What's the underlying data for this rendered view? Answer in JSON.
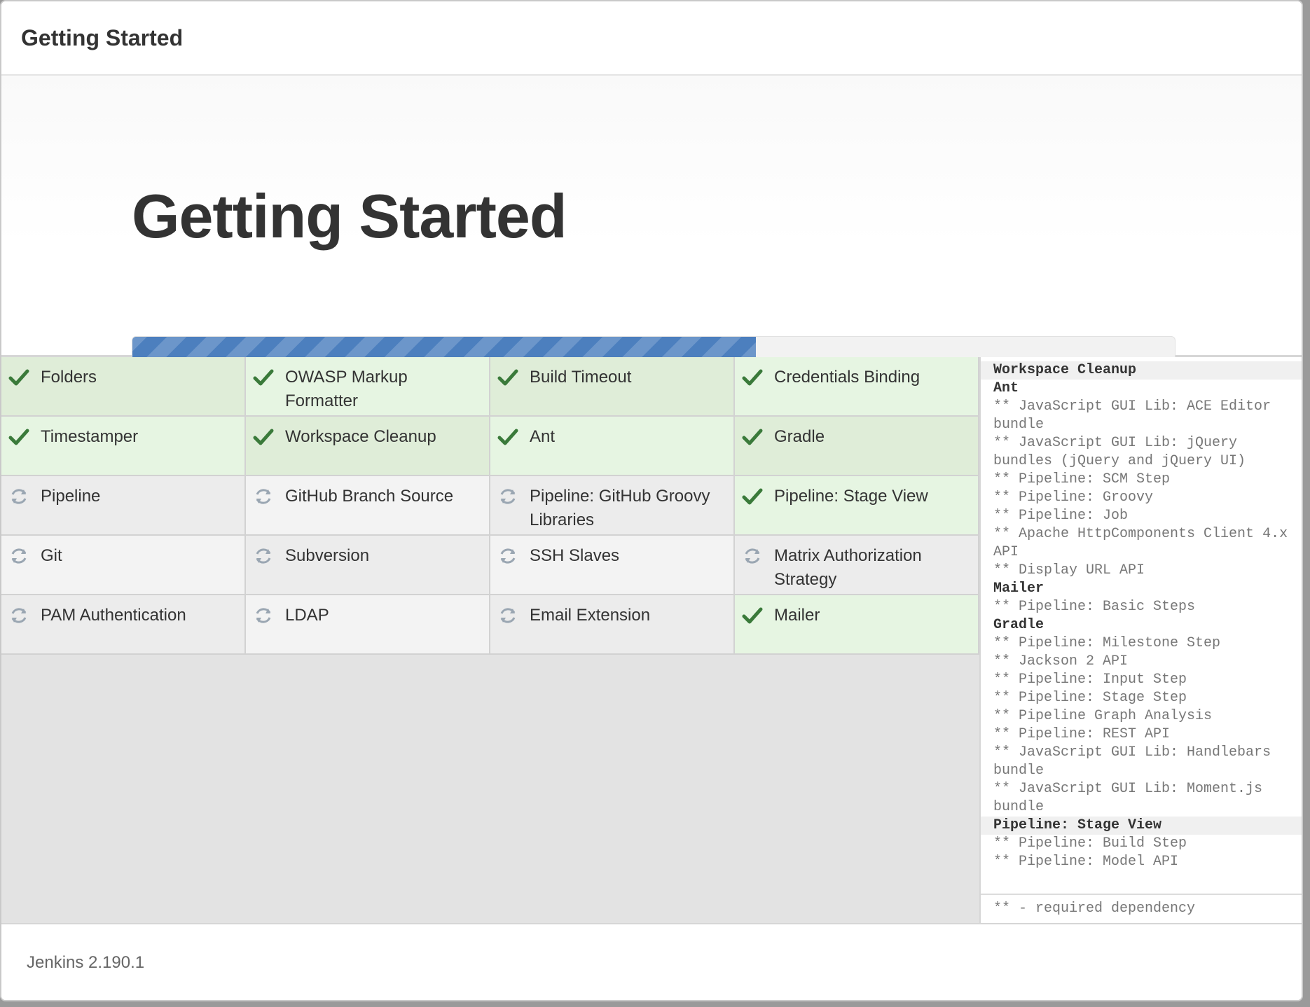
{
  "header": {
    "title": "Getting Started"
  },
  "hero": {
    "title": "Getting Started",
    "progress_fraction": 0.598
  },
  "colors": {
    "accent": "#4c7fbe",
    "success": "#3a7a3a",
    "pending": "#9aa6b2"
  },
  "plugins": [
    {
      "label": "Folders",
      "status": "done"
    },
    {
      "label": "OWASP Markup Formatter",
      "status": "done"
    },
    {
      "label": "Build Timeout",
      "status": "done"
    },
    {
      "label": "Credentials Binding",
      "status": "done"
    },
    {
      "label": "Timestamper",
      "status": "done"
    },
    {
      "label": "Workspace Cleanup",
      "status": "done"
    },
    {
      "label": "Ant",
      "status": "done"
    },
    {
      "label": "Gradle",
      "status": "done"
    },
    {
      "label": "Pipeline",
      "status": "installing"
    },
    {
      "label": "GitHub Branch Source",
      "status": "installing"
    },
    {
      "label": "Pipeline: GitHub Groovy Libraries",
      "status": "installing"
    },
    {
      "label": "Pipeline: Stage View",
      "status": "done"
    },
    {
      "label": "Git",
      "status": "installing"
    },
    {
      "label": "Subversion",
      "status": "installing"
    },
    {
      "label": "SSH Slaves",
      "status": "installing"
    },
    {
      "label": "Matrix Authorization Strategy",
      "status": "installing"
    },
    {
      "label": "PAM Authentication",
      "status": "installing"
    },
    {
      "label": "LDAP",
      "status": "installing"
    },
    {
      "label": "Email Extension",
      "status": "installing"
    },
    {
      "label": "Mailer",
      "status": "done"
    }
  ],
  "log": {
    "lines": [
      {
        "text": "Workspace Cleanup",
        "type": "head-hl"
      },
      {
        "text": "Ant",
        "type": "head"
      },
      {
        "text": "** JavaScript GUI Lib: ACE Editor bundle",
        "type": "dep"
      },
      {
        "text": "** JavaScript GUI Lib: jQuery bundles (jQuery and jQuery UI)",
        "type": "dep"
      },
      {
        "text": "** Pipeline: SCM Step",
        "type": "dep"
      },
      {
        "text": "** Pipeline: Groovy",
        "type": "dep"
      },
      {
        "text": "** Pipeline: Job",
        "type": "dep"
      },
      {
        "text": "** Apache HttpComponents Client 4.x API",
        "type": "dep"
      },
      {
        "text": "** Display URL API",
        "type": "dep"
      },
      {
        "text": "Mailer",
        "type": "head"
      },
      {
        "text": "** Pipeline: Basic Steps",
        "type": "dep"
      },
      {
        "text": "Gradle",
        "type": "head"
      },
      {
        "text": "** Pipeline: Milestone Step",
        "type": "dep"
      },
      {
        "text": "** Jackson 2 API",
        "type": "dep"
      },
      {
        "text": "** Pipeline: Input Step",
        "type": "dep"
      },
      {
        "text": "** Pipeline: Stage Step",
        "type": "dep"
      },
      {
        "text": "** Pipeline Graph Analysis",
        "type": "dep"
      },
      {
        "text": "** Pipeline: REST API",
        "type": "dep"
      },
      {
        "text": "** JavaScript GUI Lib: Handlebars bundle",
        "type": "dep"
      },
      {
        "text": "** JavaScript GUI Lib: Moment.js bundle",
        "type": "dep"
      },
      {
        "text": "Pipeline: Stage View",
        "type": "head-hl"
      },
      {
        "text": "** Pipeline: Build Step",
        "type": "dep"
      },
      {
        "text": "** Pipeline: Model API",
        "type": "dep"
      }
    ],
    "footer": "** - required dependency"
  },
  "footer": {
    "version": "Jenkins 2.190.1"
  }
}
